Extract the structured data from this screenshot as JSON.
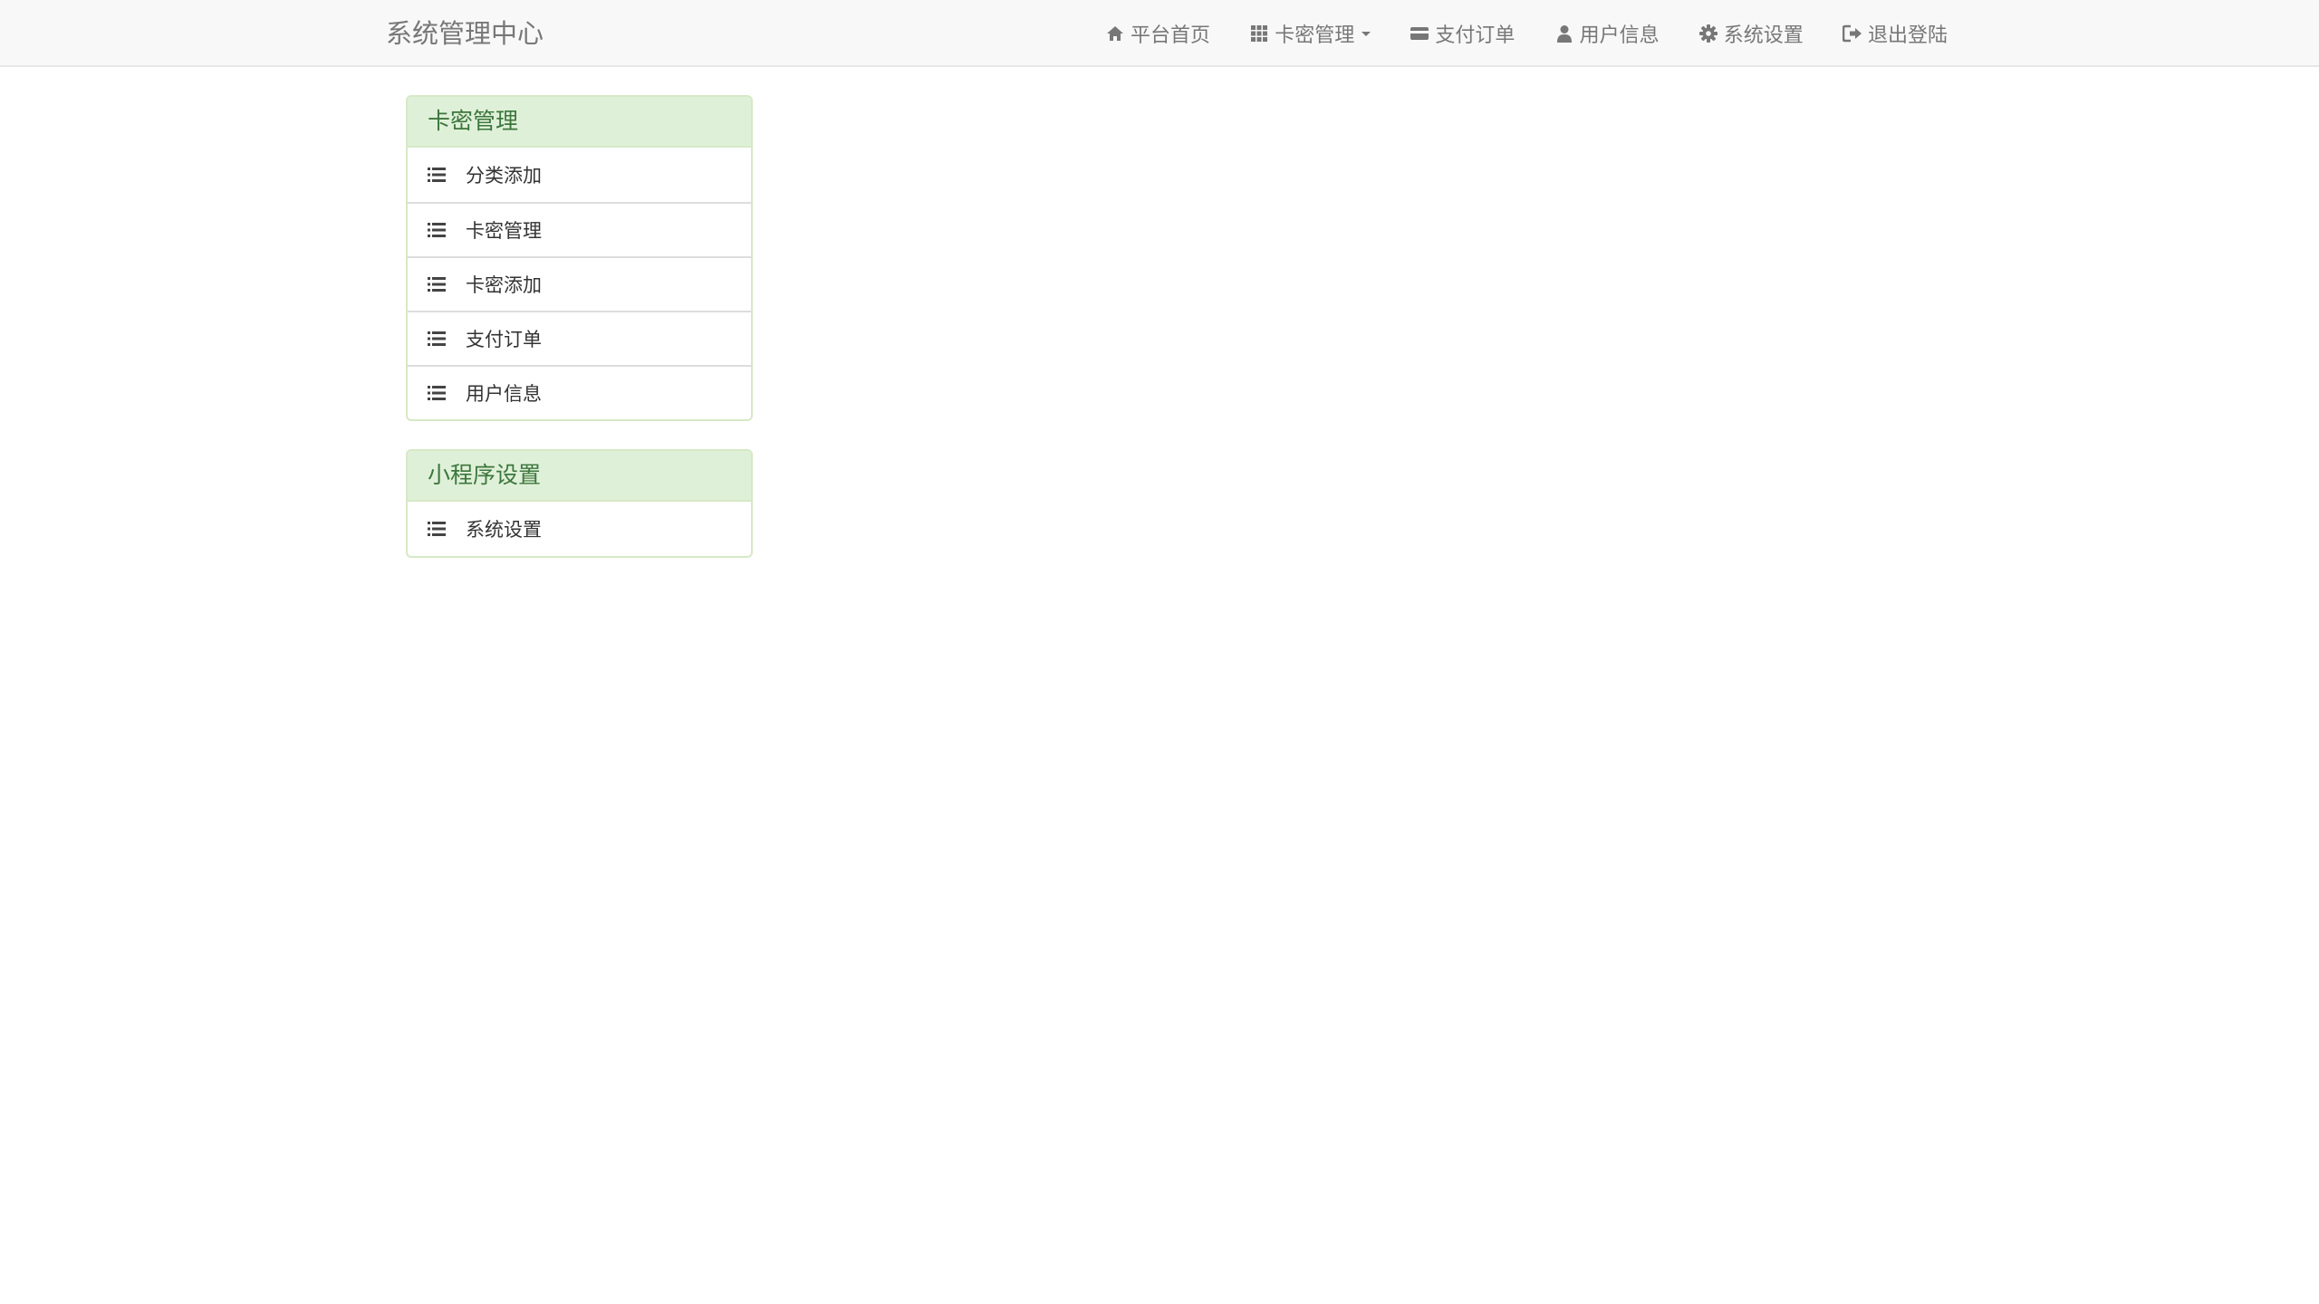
{
  "navbar": {
    "brand": "系统管理中心",
    "items": [
      {
        "label": "平台首页",
        "icon": "home-icon"
      },
      {
        "label": "卡密管理",
        "icon": "grid-icon",
        "dropdown": true
      },
      {
        "label": "支付订单",
        "icon": "credit-card-icon"
      },
      {
        "label": "用户信息",
        "icon": "user-icon"
      },
      {
        "label": "系统设置",
        "icon": "gear-icon"
      },
      {
        "label": "退出登陆",
        "icon": "logout-icon"
      }
    ]
  },
  "sidebar": {
    "panels": [
      {
        "title": "卡密管理",
        "items": [
          {
            "label": "分类添加",
            "icon": "list-icon"
          },
          {
            "label": "卡密管理",
            "icon": "list-icon"
          },
          {
            "label": "卡密添加",
            "icon": "list-icon"
          },
          {
            "label": "支付订单",
            "icon": "list-icon"
          },
          {
            "label": "用户信息",
            "icon": "list-icon"
          }
        ]
      },
      {
        "title": "小程序设置",
        "items": [
          {
            "label": "系统设置",
            "icon": "list-icon"
          }
        ]
      }
    ]
  },
  "colors": {
    "navbar_bg": "#f8f8f8",
    "nav_text": "#777777",
    "panel_heading_bg": "#dff0d8",
    "panel_heading_text": "#3c763d",
    "panel_border": "#d6e9c6"
  }
}
